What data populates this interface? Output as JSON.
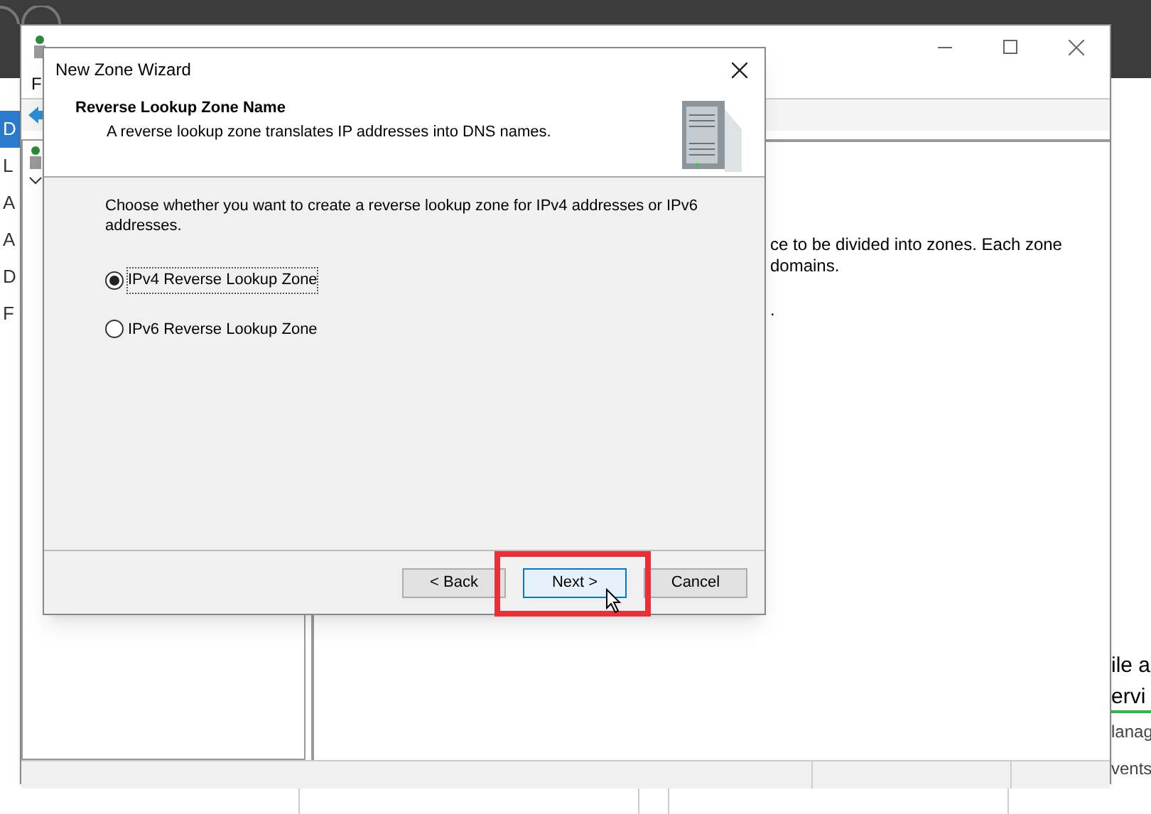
{
  "server_manager": {
    "nav_items": [
      {
        "label": "D",
        "selected": true
      },
      {
        "label": "L",
        "selected": false
      },
      {
        "label": "A",
        "selected": false
      },
      {
        "label": "A",
        "selected": false
      },
      {
        "label": "D",
        "selected": false
      },
      {
        "label": "F",
        "selected": false
      }
    ],
    "side_texts": [
      {
        "text": "ile a",
        "kind": "heading"
      },
      {
        "text": "ervi",
        "kind": "link"
      },
      {
        "text": "lanag",
        "kind": "plain"
      },
      {
        "text": "vents",
        "kind": "plain"
      }
    ]
  },
  "dns_manager": {
    "menu": [
      "F"
    ],
    "content_lines": [
      "ce to be divided into zones. Each zone",
      "domains.",
      "."
    ]
  },
  "wizard": {
    "title": "New Zone Wizard",
    "heading": "Reverse Lookup Zone Name",
    "subheading": "A reverse lookup zone translates IP addresses into DNS names.",
    "prompt": "Choose whether you want to create a reverse lookup zone for IPv4 addresses or IPv6 addresses.",
    "options": [
      {
        "label": "IPv4 Reverse Lookup Zone",
        "selected": true
      },
      {
        "label": "IPv6 Reverse Lookup Zone",
        "selected": false
      }
    ],
    "buttons": [
      {
        "label": "< Back",
        "highlighted": false
      },
      {
        "label": "Next >",
        "highlighted": true
      },
      {
        "label": "Cancel",
        "highlighted": false
      }
    ]
  }
}
